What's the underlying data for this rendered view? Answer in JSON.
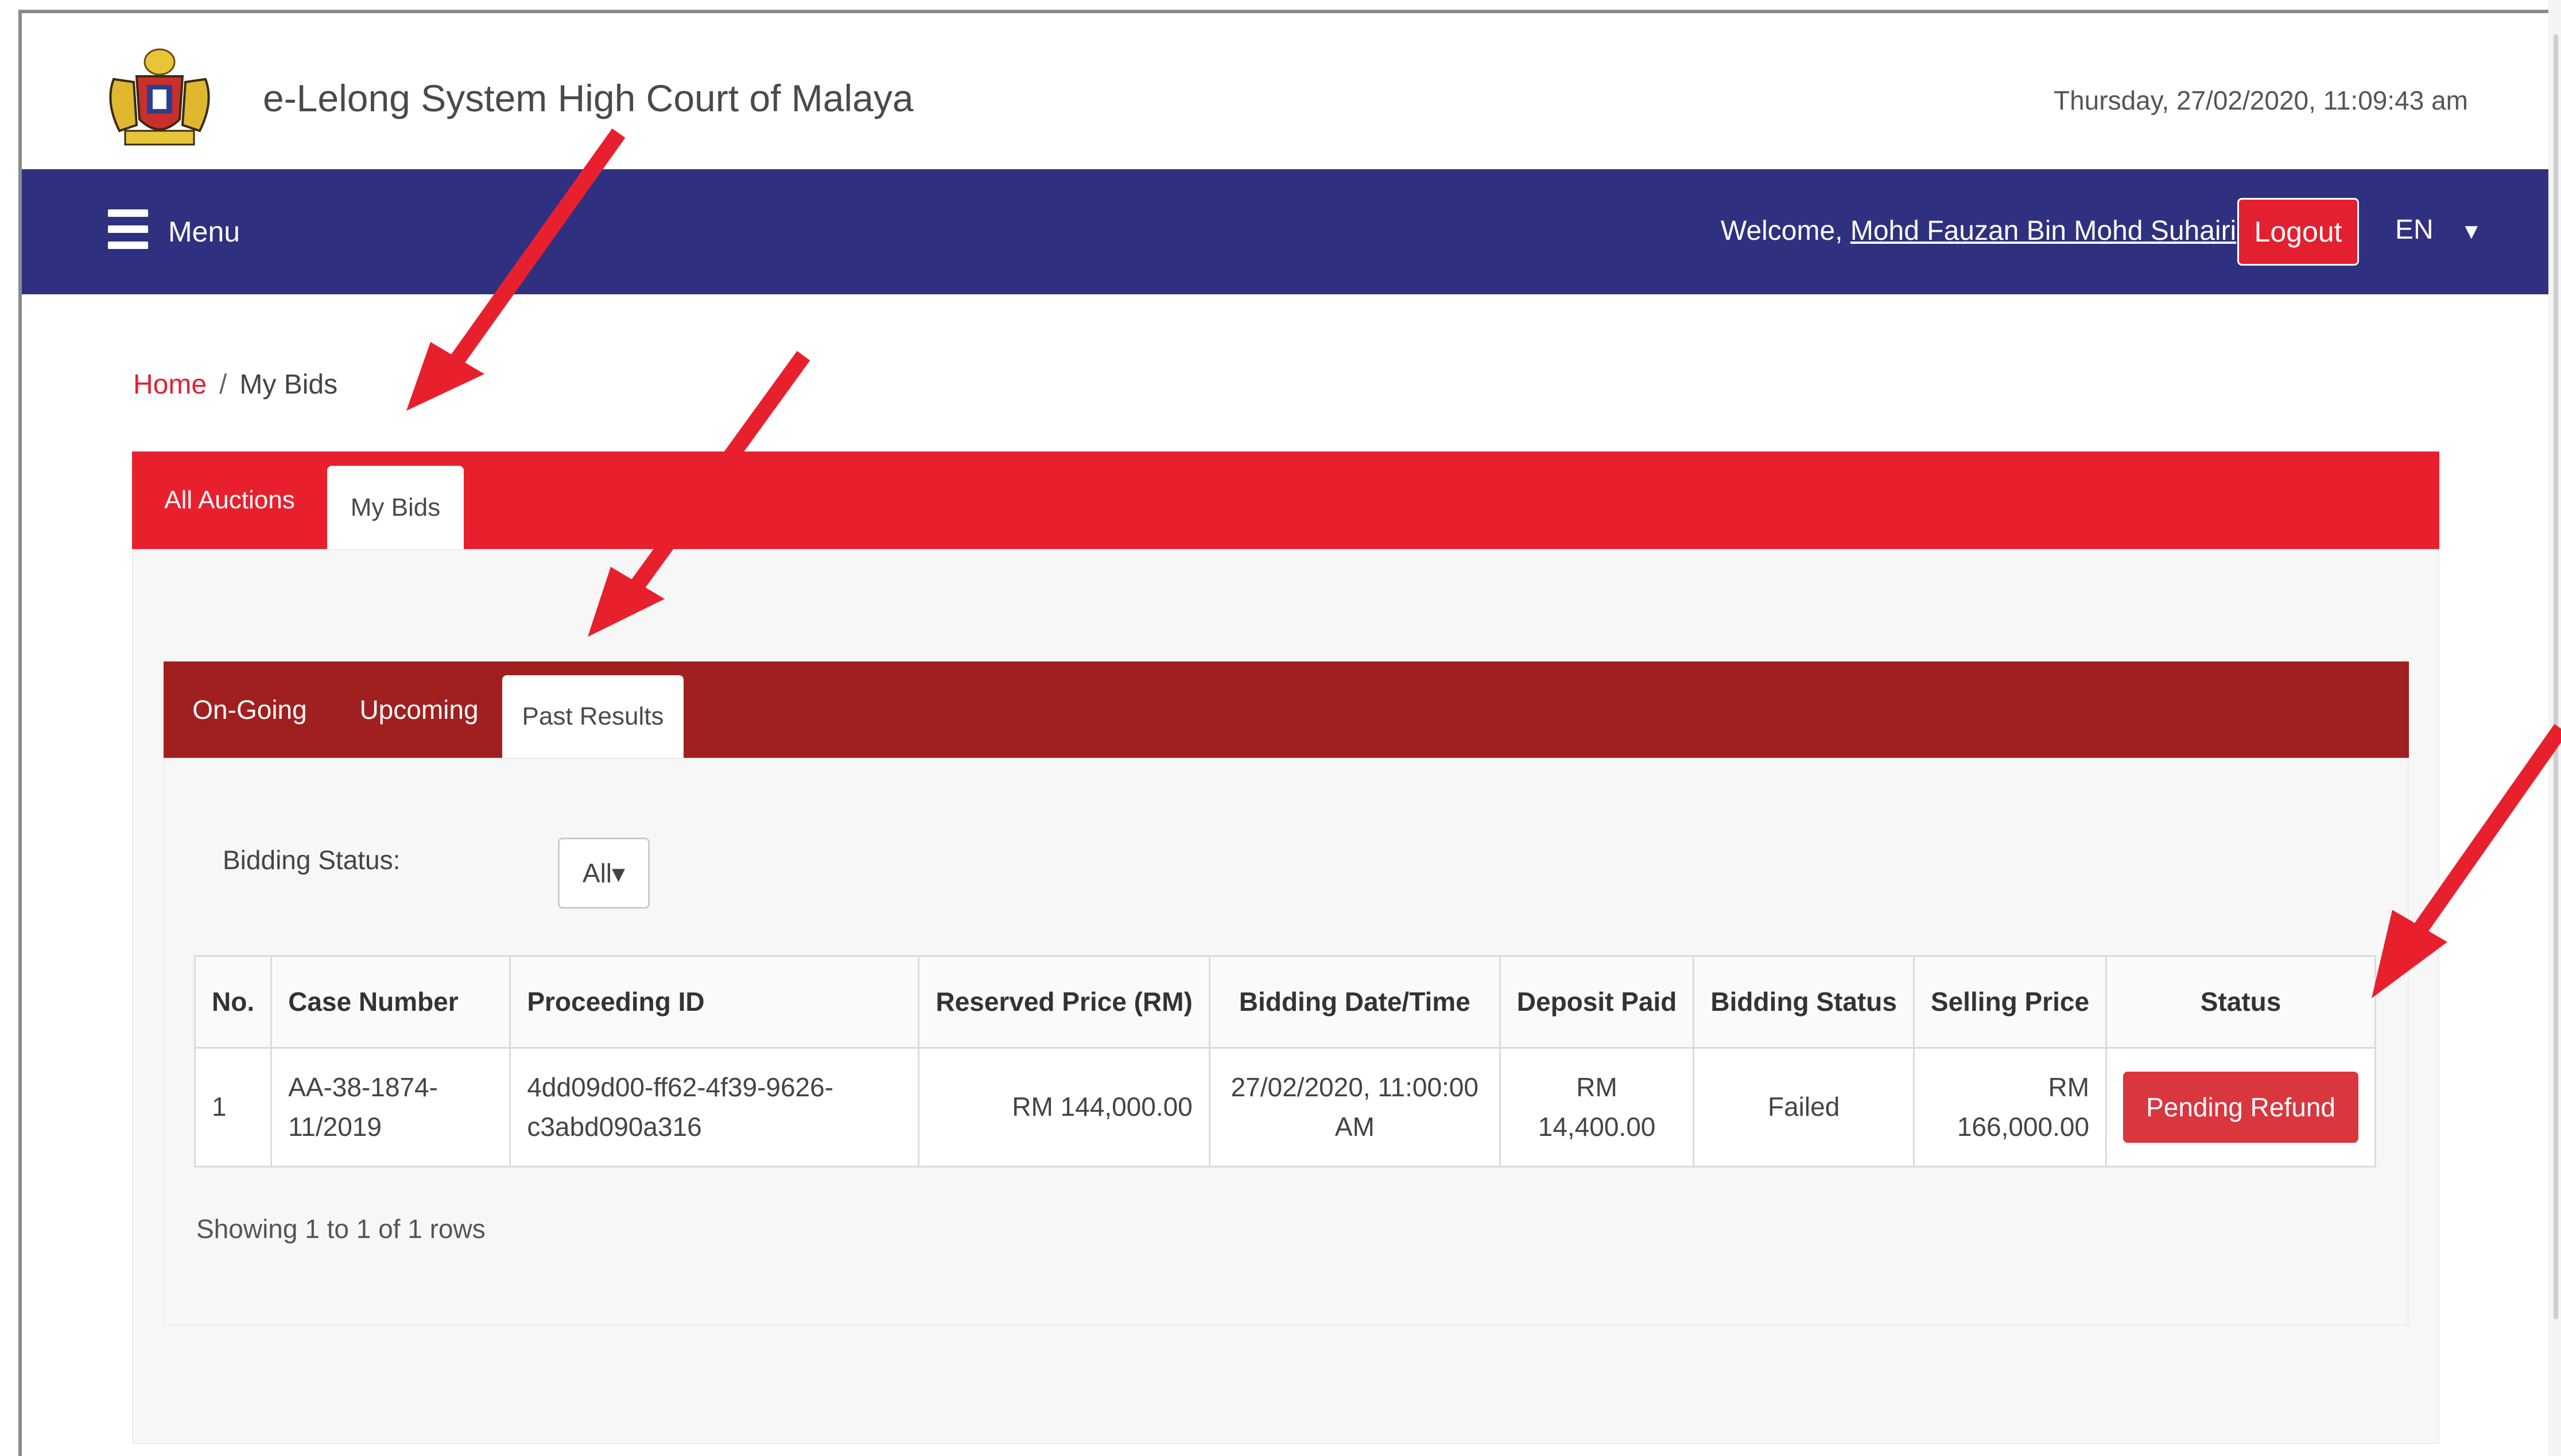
{
  "header": {
    "title": "e-Lelong System High Court of Malaya",
    "datetime": "Thursday, 27/02/2020, 11:09:43 am"
  },
  "navbar": {
    "menu_label": "Menu",
    "welcome_prefix": "Welcome, ",
    "user_name": "Mohd Fauzan Bin Mohd Suhairi",
    "welcome_suffix": "!",
    "logout_label": "Logout",
    "language": "EN",
    "language_caret": "▼"
  },
  "breadcrumb": {
    "home": "Home",
    "separator": "/",
    "current": "My Bids"
  },
  "main_tabs": [
    {
      "label": "All Auctions",
      "active": false
    },
    {
      "label": "My Bids",
      "active": true
    }
  ],
  "sub_tabs": [
    {
      "label": "On-Going",
      "active": false
    },
    {
      "label": "Upcoming",
      "active": false
    },
    {
      "label": "Past Results",
      "active": true
    }
  ],
  "filter": {
    "label": "Bidding Status:",
    "selected": "All▾"
  },
  "table": {
    "columns": [
      "No.",
      "Case Number",
      "Proceeding ID",
      "Reserved Price (RM)",
      "Bidding Date/Time",
      "Deposit Paid",
      "Bidding Status",
      "Selling Price",
      "Status"
    ],
    "rows": [
      {
        "no": "1",
        "case_number": "AA-38-1874-11/2019",
        "proceeding_id": "4dd09d00-ff62-4f39-9626-c3abd090a316",
        "reserved_price": "RM 144,000.00",
        "bidding_datetime": "27/02/2020, 11:00:00 AM",
        "deposit_paid": "RM 14,400.00",
        "bidding_status": "Failed",
        "selling_price": "RM 166,000.00",
        "status": "Pending Refund"
      }
    ]
  },
  "rows_info": "Showing 1 to 1 of 1 rows",
  "colors": {
    "navbar": "#303080",
    "main_tabbar": "#e8202e",
    "sub_tabbar": "#a02020",
    "status_button": "#d9363e",
    "annotation_arrow": "#e8202e"
  }
}
